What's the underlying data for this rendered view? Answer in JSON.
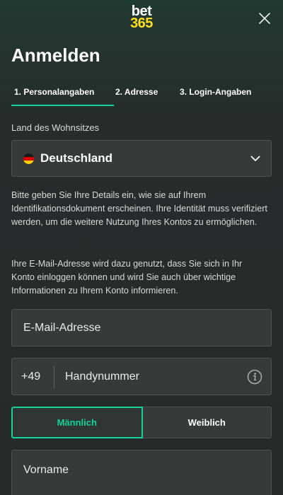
{
  "header": {
    "logo_top": "bet",
    "logo_bottom": "365",
    "close_icon": "close-icon"
  },
  "page": {
    "title": "Anmelden"
  },
  "tabs": [
    {
      "label": "1.  Personalangaben",
      "active": true
    },
    {
      "label": "2.  Adresse",
      "active": false
    },
    {
      "label": "3.  Login-Angaben",
      "active": false
    }
  ],
  "country": {
    "label": "Land des Wohnsitzes",
    "value": "Deutschland",
    "flag_icon": "germany-flag-icon",
    "dropdown_icon": "chevron-down-icon"
  },
  "info": {
    "paragraph1": "Bitte geben Sie Ihre Details ein, wie sie auf Ihrem Identifikationsdokument erscheinen. Ihre Identität muss verifiziert werden, um die weitere Nutzung Ihres Kontos zu ermöglichen.",
    "paragraph2": "Ihre E-Mail-Adresse wird dazu genutzt, dass Sie sich in Ihr Konto einloggen können und wird Sie auch über wichtige Informationen zu Ihrem Konto informieren."
  },
  "form": {
    "email_placeholder": "E-Mail-Adresse",
    "phone_prefix": "+49",
    "phone_placeholder": "Handynummer",
    "gender_male": "Männlich",
    "gender_female": "Weiblich",
    "firstname_placeholder": "Vorname"
  },
  "colors": {
    "accent": "#14d39a",
    "brand_yellow": "#ffdf1b",
    "background": "#262b2a",
    "field_bg": "#363b3a"
  }
}
